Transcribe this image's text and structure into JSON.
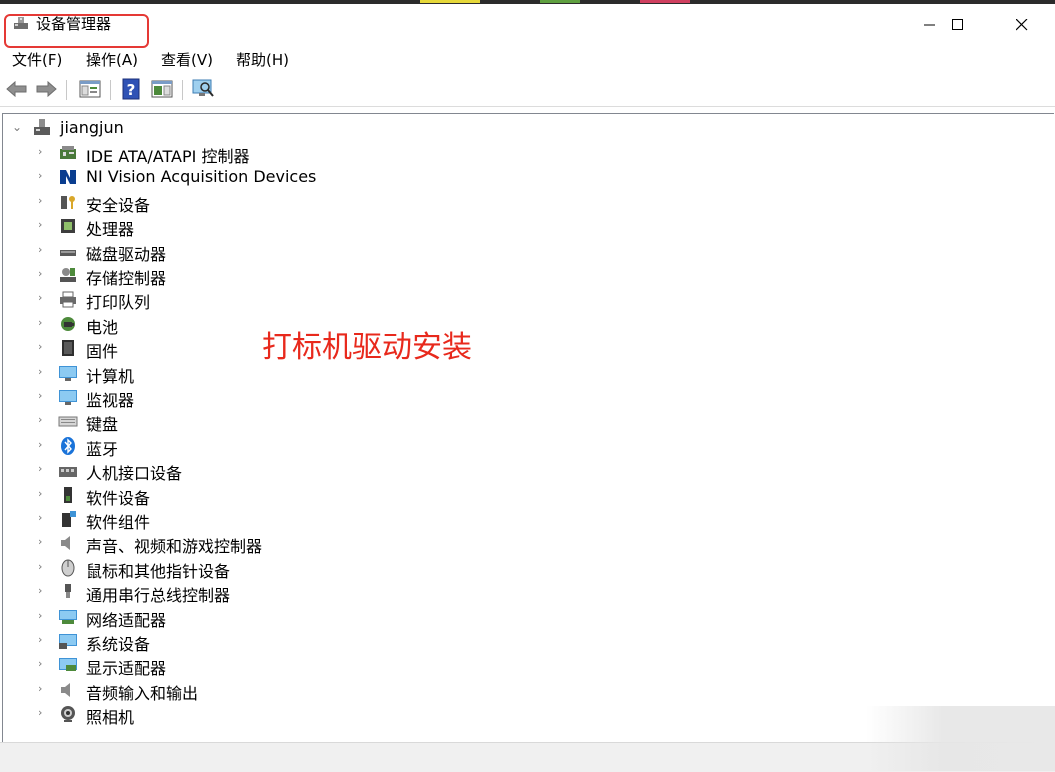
{
  "window": {
    "title": "设备管理器",
    "accent_color": "#e53935"
  },
  "menu": {
    "items": [
      {
        "label": "文件(F)"
      },
      {
        "label": "操作(A)"
      },
      {
        "label": "查看(V)"
      },
      {
        "label": "帮助(H)"
      }
    ]
  },
  "toolbar": {
    "buttons": [
      {
        "icon": "back-arrow-icon"
      },
      {
        "icon": "forward-arrow-icon"
      },
      {
        "icon": "show-hide-tree-icon"
      },
      {
        "icon": "help-icon"
      },
      {
        "icon": "properties-icon"
      },
      {
        "icon": "scan-hardware-icon"
      }
    ]
  },
  "tree": {
    "root": {
      "label": "jiangjun",
      "expanded": true
    },
    "items": [
      {
        "label": "IDE ATA/ATAPI 控制器",
        "icon": "ide-controller-icon"
      },
      {
        "label": "NI Vision Acquisition Devices",
        "icon": "ni-vision-icon"
      },
      {
        "label": "安全设备",
        "icon": "security-device-icon"
      },
      {
        "label": "处理器",
        "icon": "processor-icon"
      },
      {
        "label": "磁盘驱动器",
        "icon": "disk-drive-icon"
      },
      {
        "label": "存储控制器",
        "icon": "storage-controller-icon"
      },
      {
        "label": "打印队列",
        "icon": "printer-icon"
      },
      {
        "label": "电池",
        "icon": "battery-icon"
      },
      {
        "label": "固件",
        "icon": "firmware-icon"
      },
      {
        "label": "计算机",
        "icon": "computer-icon"
      },
      {
        "label": "监视器",
        "icon": "monitor-icon"
      },
      {
        "label": "键盘",
        "icon": "keyboard-icon"
      },
      {
        "label": "蓝牙",
        "icon": "bluetooth-icon"
      },
      {
        "label": "人机接口设备",
        "icon": "hid-icon"
      },
      {
        "label": "软件设备",
        "icon": "software-device-icon"
      },
      {
        "label": "软件组件",
        "icon": "software-component-icon"
      },
      {
        "label": "声音、视频和游戏控制器",
        "icon": "sound-icon"
      },
      {
        "label": "鼠标和其他指针设备",
        "icon": "mouse-icon"
      },
      {
        "label": "通用串行总线控制器",
        "icon": "usb-icon"
      },
      {
        "label": "网络适配器",
        "icon": "network-adapter-icon"
      },
      {
        "label": "系统设备",
        "icon": "system-device-icon"
      },
      {
        "label": "显示适配器",
        "icon": "display-adapter-icon"
      },
      {
        "label": "音频输入和输出",
        "icon": "audio-io-icon"
      },
      {
        "label": "照相机",
        "icon": "camera-icon"
      }
    ]
  },
  "annotation": {
    "text": "打标机驱动安装",
    "color": "#e8291c"
  }
}
